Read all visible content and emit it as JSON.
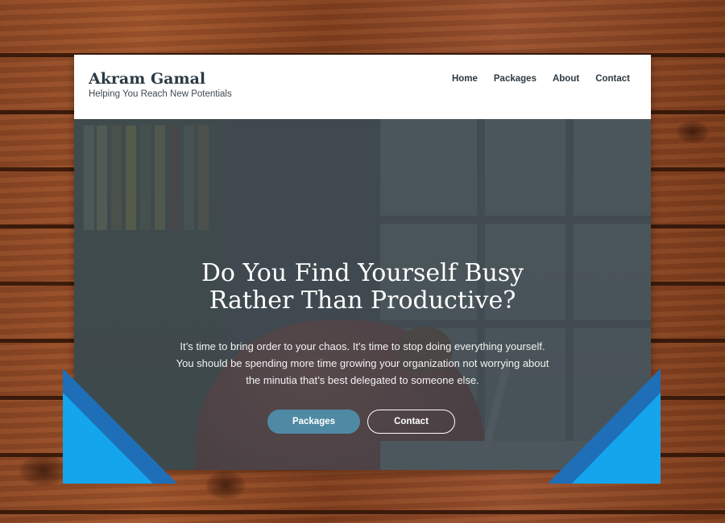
{
  "site": {
    "name": "Akram Gamal",
    "tagline": "Helping You Reach New Potentials"
  },
  "nav": {
    "items": [
      {
        "label": "Home"
      },
      {
        "label": "Packages"
      },
      {
        "label": "About"
      },
      {
        "label": "Contact"
      }
    ]
  },
  "hero": {
    "headline_lines": [
      "Do You Find Yourself Busy",
      "Rather Than Productive?"
    ],
    "subtext_lines": [
      "It’s time to bring order to your chaos. It’s time to stop doing everything yourself.",
      "You should be spending more time growing your organization not worrying about",
      "the minutia that’s best delegated to someone else."
    ],
    "buttons": {
      "packages": "Packages",
      "contact": "Contact"
    }
  },
  "colors": {
    "accent_button": "#4f8aa5",
    "overlay": "#374248",
    "triangle_dark": "#1e6fb8",
    "triangle_light": "#14a5ec",
    "wood": "#8a4624"
  }
}
